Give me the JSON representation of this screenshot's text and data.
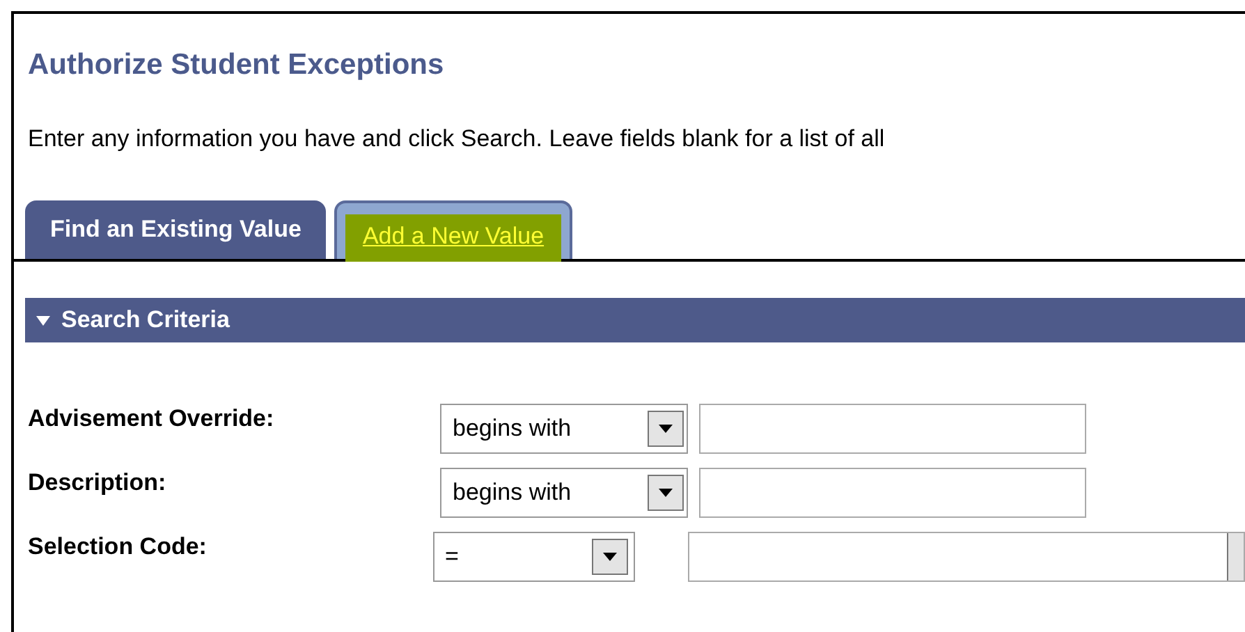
{
  "title": "Authorize Student Exceptions",
  "instructions": "Enter any information you have and click Search. Leave fields blank for a list of all",
  "tabs": [
    {
      "label": "Find an Existing Value",
      "selected": true
    },
    {
      "label": "Add a New Value",
      "selected": false
    }
  ],
  "section": {
    "title": "Search Criteria",
    "expanded": true
  },
  "fields": [
    {
      "label": "Advisement Override:",
      "operator": "begins with",
      "kind": "text"
    },
    {
      "label": "Description:",
      "operator": "begins with",
      "kind": "text"
    },
    {
      "label": "Selection Code:",
      "operator": "=",
      "kind": "lookup"
    }
  ]
}
